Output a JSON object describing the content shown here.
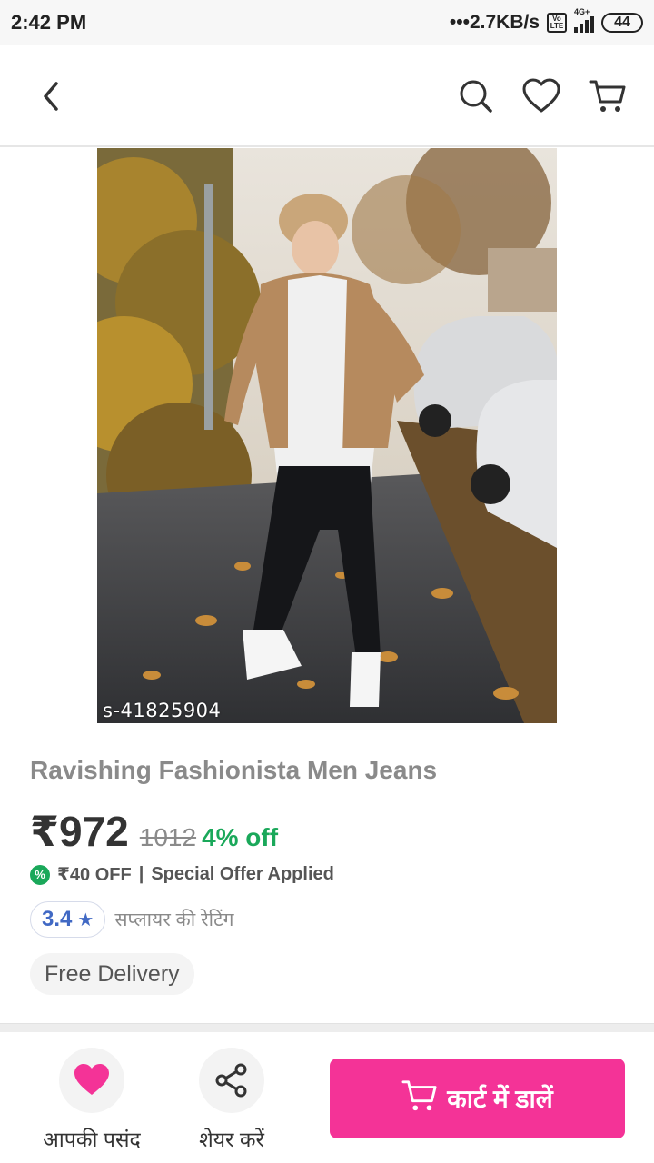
{
  "status_bar": {
    "time": "2:42 PM",
    "network_speed": "•••2.7KB/s",
    "volte": "Vo LTE",
    "network_type": "4G+",
    "battery": "44"
  },
  "header": {
    "back_icon": "chevron-left-icon",
    "search_icon": "search-icon",
    "wishlist_icon": "heart-outline-icon",
    "cart_icon": "cart-icon"
  },
  "product": {
    "sku": "s-41825904",
    "title": "Ravishing Fashionista Men Jeans",
    "price": "₹972",
    "mrp": "1012",
    "discount": "4% off",
    "offer_amount": "₹40 OFF",
    "offer_separator": "|",
    "offer_text": "Special Offer Applied",
    "rating": "3.4",
    "rating_label": "सप्लायर की रेटिंग",
    "delivery": "Free Delivery"
  },
  "bottom_bar": {
    "wishlist_label": "आपकी पसंद",
    "share_label": "शेयर करें",
    "add_to_cart_label": "कार्ट में डालें"
  },
  "colors": {
    "accent_pink": "#f43397",
    "discount_green": "#1aa85a",
    "rating_blue": "#4169c4"
  }
}
